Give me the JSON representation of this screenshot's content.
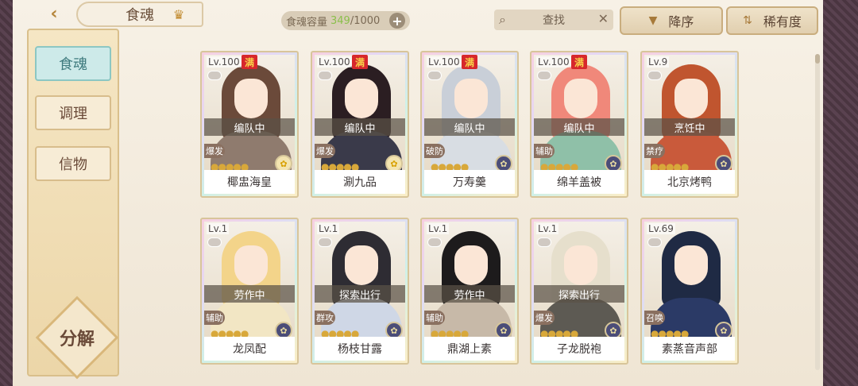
{
  "header": {
    "title": "食魂",
    "capacity_label": "食魂容量",
    "capacity_value": "349",
    "capacity_max": "/1000",
    "plus": "+",
    "search_placeholder": "查找",
    "sort_order": "降序",
    "sort_by": "稀有度"
  },
  "sidebar": {
    "items": [
      {
        "label": "食魂"
      },
      {
        "label": "调理"
      },
      {
        "label": "信物"
      }
    ],
    "decompose": "分解"
  },
  "colors": {
    "accent": "#8cc7c3",
    "capacity_number": "#8bbf4b",
    "max_badge": "#d7272c"
  },
  "cards": [
    {
      "level": "Lv.100",
      "max": "满",
      "status": "编队中",
      "role": "爆发",
      "name": "椰盅海皇",
      "element": "gold"
    },
    {
      "level": "Lv.100",
      "max": "满",
      "status": "编队中",
      "role": "爆发",
      "name": "涮九品",
      "element": "gold"
    },
    {
      "level": "Lv.100",
      "max": "满",
      "status": "编队中",
      "role": "破防",
      "name": "万寿羹",
      "element": "dark"
    },
    {
      "level": "Lv.100",
      "max": "满",
      "status": "编队中",
      "role": "辅助",
      "name": "绵羊盖被",
      "element": "dark"
    },
    {
      "level": "Lv.9",
      "max": "",
      "status": "烹饪中",
      "role": "禁疗",
      "name": "北京烤鸭",
      "element": "dark"
    },
    {
      "level": "Lv.1",
      "max": "",
      "status": "劳作中",
      "role": "辅助",
      "name": "龙凤配",
      "element": "dark"
    },
    {
      "level": "Lv.1",
      "max": "",
      "status": "探索出行",
      "role": "群攻",
      "name": "杨枝甘露",
      "element": "dark"
    },
    {
      "level": "Lv.1",
      "max": "",
      "status": "劳作中",
      "role": "辅助",
      "name": "鼎湖上素",
      "element": "dark"
    },
    {
      "level": "Lv.1",
      "max": "",
      "status": "探索出行",
      "role": "爆发",
      "name": "子龙脱袍",
      "element": "dark"
    },
    {
      "level": "Lv.69",
      "max": "",
      "status": "",
      "role": "召唤",
      "name": "素蒸音声部",
      "element": "dark"
    }
  ]
}
